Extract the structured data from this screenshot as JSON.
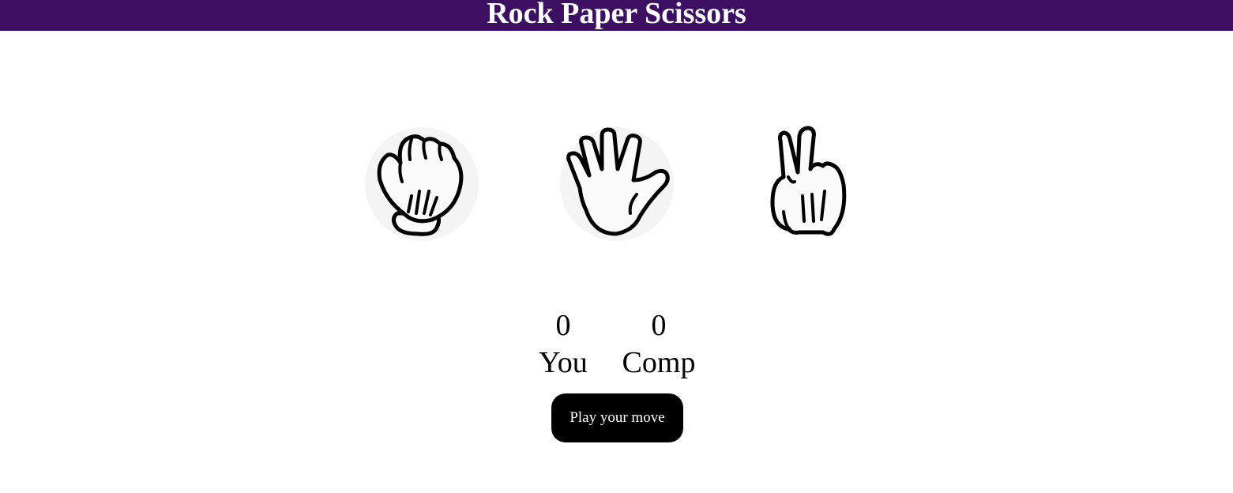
{
  "header": {
    "title": "Rock Paper Scissors",
    "background_color": "#3c0f63"
  },
  "choices": [
    {
      "id": "rock",
      "icon": "rock-fist-icon"
    },
    {
      "id": "paper",
      "icon": "paper-open-hand-icon"
    },
    {
      "id": "scissors",
      "icon": "scissors-two-fingers-icon"
    }
  ],
  "scoreboard": {
    "user_score": "0",
    "user_label": "You",
    "comp_score": "0",
    "comp_label": "Comp"
  },
  "message": {
    "text": "Play your move",
    "background_color": "#000000"
  }
}
